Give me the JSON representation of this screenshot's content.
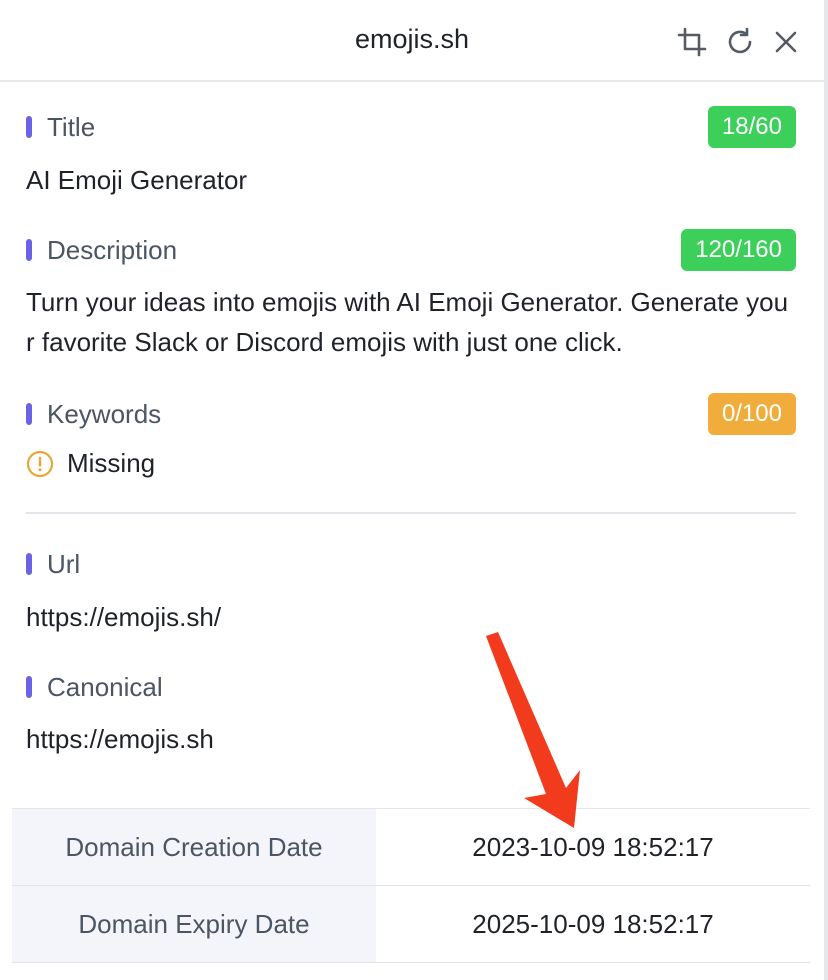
{
  "header": {
    "title": "emojis.sh",
    "icons": [
      "crop-icon",
      "refresh-icon",
      "close-icon"
    ]
  },
  "sections": {
    "title": {
      "label": "Title",
      "badge": "18/60",
      "badge_color": "#3ccf5a",
      "value": "AI Emoji Generator"
    },
    "description": {
      "label": "Description",
      "badge": "120/160",
      "badge_color": "#3ccf5a",
      "value": "Turn your ideas into emojis with AI Emoji Generator. Generate your favorite Slack or Discord emojis with just one click."
    },
    "keywords": {
      "label": "Keywords",
      "badge": "0/100",
      "badge_color": "#f0ad3c",
      "status_icon": "warning-circle-icon",
      "value": "Missing"
    },
    "url": {
      "label": "Url",
      "value": "https://emojis.sh/"
    },
    "canonical": {
      "label": "Canonical",
      "value": "https://emojis.sh"
    }
  },
  "domain_info": [
    {
      "key": "Domain Creation Date",
      "value": "2023-10-09 18:52:17"
    },
    {
      "key": "Domain Expiry Date",
      "value": "2025-10-09 18:52:17"
    }
  ],
  "colors": {
    "accent_bar": "#6b63e6",
    "annotation_arrow": "#f23a1d"
  }
}
